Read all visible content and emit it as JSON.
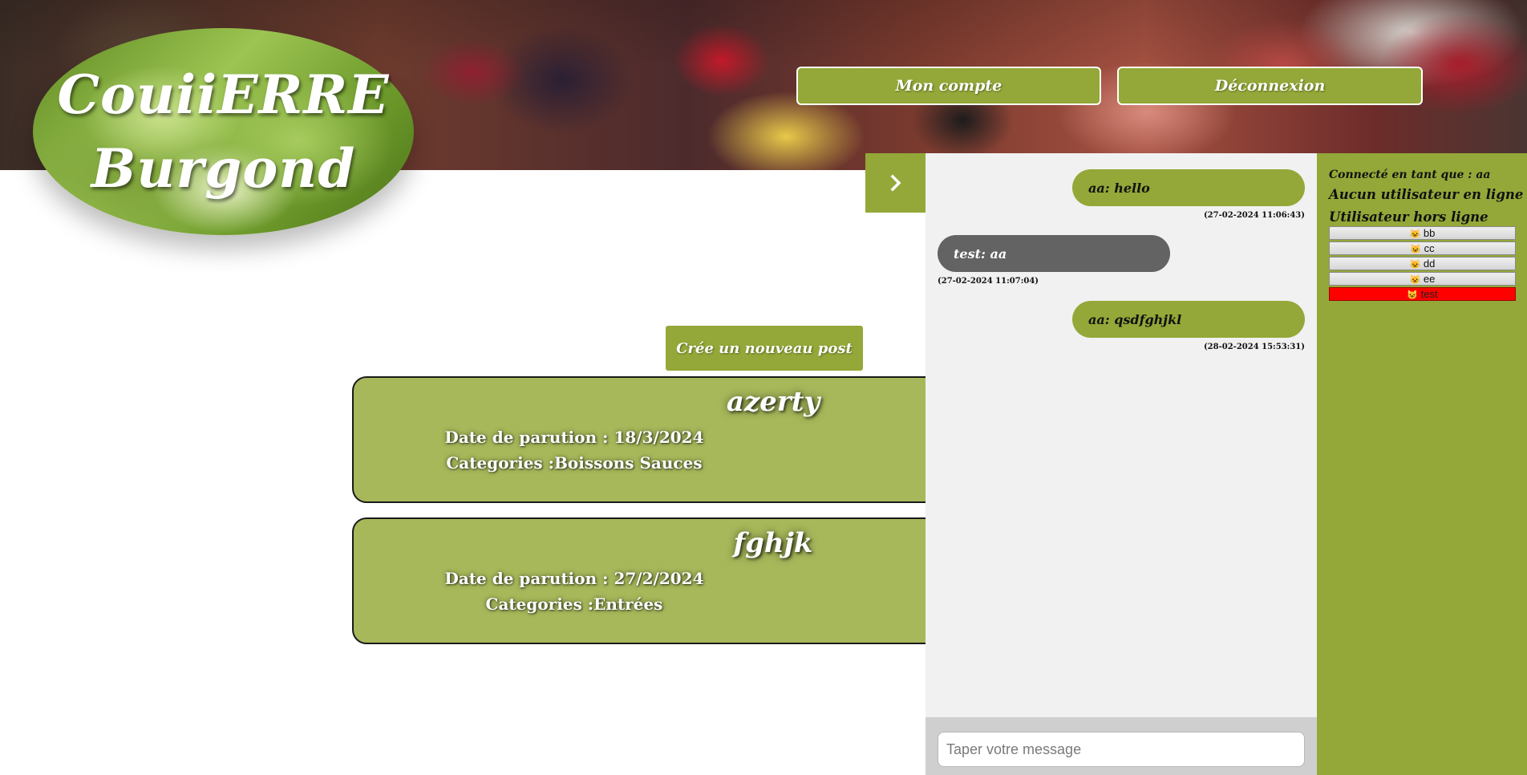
{
  "header": {
    "logo_line1": "CouiiERRE",
    "logo_line2": "Burgond",
    "account_label": "Mon compte",
    "logout_label": "Déconnexion"
  },
  "main": {
    "new_post_label": "Crée un nouveau post",
    "posts": [
      {
        "title": "azerty",
        "date": "Date de parution : 18/3/2024",
        "categories": "Categories :Boissons Sauces"
      },
      {
        "title": "fghjk",
        "date": "Date de parution : 27/2/2024",
        "categories": "Categories :Entrées"
      }
    ]
  },
  "chat": {
    "toggle_icon": "chevron-right-icon",
    "messages": [
      {
        "text": "aa: hello",
        "time": "(27-02-2024 11:06:43)",
        "side": "right"
      },
      {
        "text": "test: aa",
        "time": "(27-02-2024 11:07:04)",
        "side": "left"
      },
      {
        "text": "aa: qsdfghjkl",
        "time": "(28-02-2024 15:53:31)",
        "side": "right"
      }
    ],
    "input_placeholder": "Taper votre message"
  },
  "users": {
    "connected_as": "Connecté en tant que : aa",
    "online_heading": "Aucun utilisateur en ligne",
    "offline_heading": "Utilisateur hors ligne",
    "offline_list": [
      {
        "name": "bb",
        "icon": "cat-face-icon",
        "highlight": false
      },
      {
        "name": "cc",
        "icon": "cat-face-icon",
        "highlight": false
      },
      {
        "name": "dd",
        "icon": "cat-face-icon",
        "highlight": false
      },
      {
        "name": "ee",
        "icon": "cat-face-icon",
        "highlight": false
      },
      {
        "name": "test",
        "icon": "cat-face-icon",
        "highlight": true
      }
    ]
  },
  "colors": {
    "accent": "#93a838",
    "card": "#a6b85a",
    "other_bubble": "#636363",
    "highlight_user": "#ff0000"
  }
}
